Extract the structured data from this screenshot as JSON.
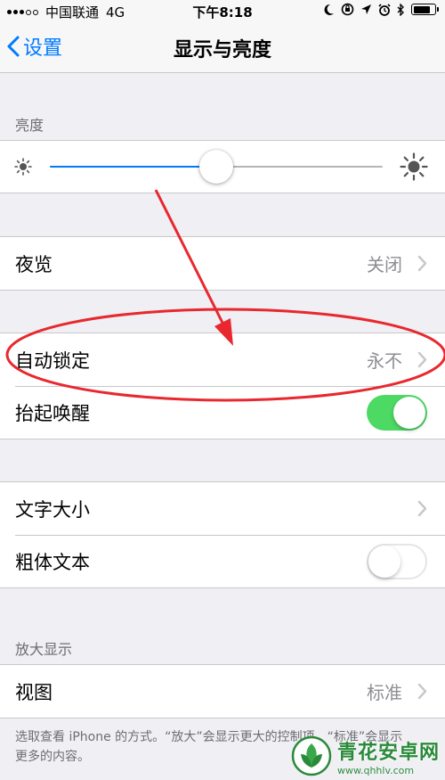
{
  "status_bar": {
    "carrier": "中国联通",
    "network": "4G",
    "time": "下午8:18"
  },
  "nav": {
    "back_label": "设置",
    "title": "显示与亮度"
  },
  "brightness": {
    "header": "亮度",
    "level": 0.5
  },
  "rows": {
    "night_shift": {
      "label": "夜览",
      "value": "关闭"
    },
    "auto_lock": {
      "label": "自动锁定",
      "value": "永不"
    },
    "raise_to_wake": {
      "label": "抬起唤醒",
      "on": true
    },
    "text_size": {
      "label": "文字大小"
    },
    "bold_text": {
      "label": "粗体文本",
      "on": false
    }
  },
  "zoom": {
    "header": "放大显示",
    "view_label": "视图",
    "view_value": "标准",
    "footer": "选取查看 iPhone 的方式。“放大”会显示更大的控制项。“标准”会显示更多的内容。"
  },
  "watermark": {
    "name": "青花安卓网",
    "url": "www.qhhlv.com"
  },
  "colors": {
    "accent": "#007aff",
    "switch_on": "#4cd964",
    "annotation": "#e8282e"
  }
}
